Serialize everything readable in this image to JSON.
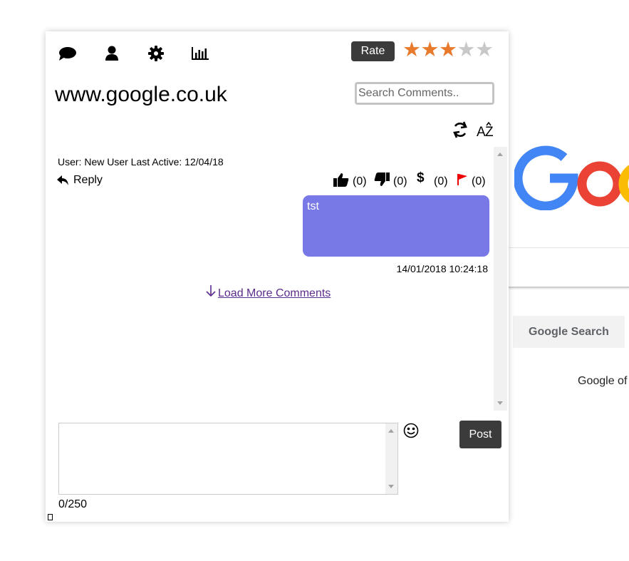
{
  "background": {
    "google_search_label": "Google Search",
    "offered_text": "Google of",
    "logo_colors": [
      "#4285F4",
      "#EA4335",
      "#FBBC05"
    ]
  },
  "toolbar": {
    "icons": [
      "comments-icon",
      "user-icon",
      "gear-icon",
      "bar-chart-icon"
    ],
    "rate_label": "Rate",
    "rating": 3,
    "rating_max": 5,
    "star_on_color": "#e87a2c",
    "star_off_color": "#c8c8c8"
  },
  "site": {
    "title": "www.google.co.uk"
  },
  "search": {
    "placeholder": "Search Comments.."
  },
  "comment": {
    "user_line": "User: New User Last Active: 12/04/18",
    "reply_label": "Reply",
    "likes": "(0)",
    "dislikes": "(0)",
    "donations": "(0)",
    "flags": "(0)",
    "text": "tst",
    "timestamp": "14/01/2018 10:24:18",
    "bubble_color": "#7878e6"
  },
  "load_more_label": "Load More Comments",
  "composer": {
    "value": "",
    "char_count": "0/250",
    "post_label": "Post"
  }
}
